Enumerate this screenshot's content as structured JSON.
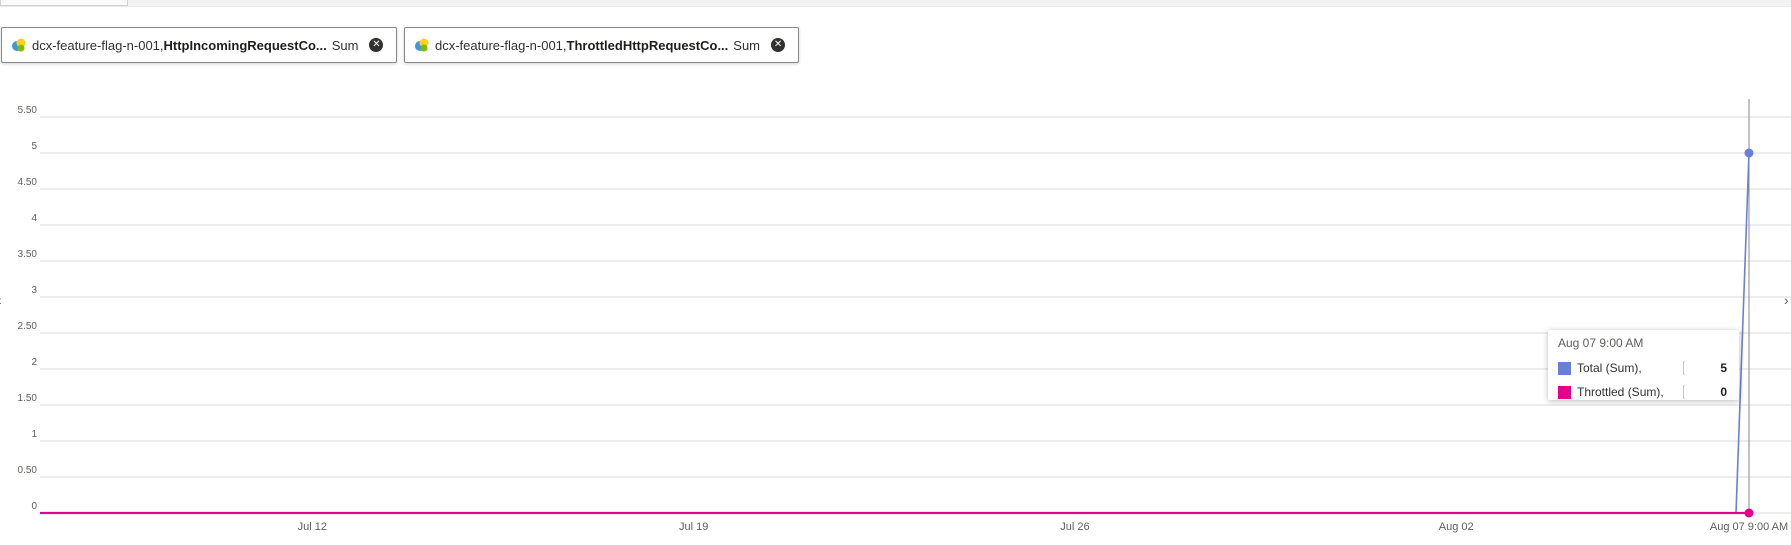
{
  "pills": [
    {
      "resource": "dcx-feature-flag-n-001,",
      "metric": "HttpIncomingRequestCo...",
      "aggregation": "Sum",
      "icon": "resource-icon"
    },
    {
      "resource": "dcx-feature-flag-n-001,",
      "metric": "ThrottledHttpRequestCo...",
      "aggregation": "Sum",
      "icon": "resource-icon"
    }
  ],
  "tooltip": {
    "title": "Aug 07 9:00 AM",
    "rows": [
      {
        "label": "Total (Sum),",
        "value": "5",
        "color": "#6a7fdb"
      },
      {
        "label": "Throttled (Sum),",
        "value": "0",
        "color": "#e3008c"
      }
    ]
  },
  "icons": {
    "close": "close-circle-icon",
    "nav_left": "chevron-left-icon",
    "nav_right": "chevron-right-icon"
  },
  "chart_data": {
    "type": "line",
    "x_range": [
      "Jul 07 2024",
      "Aug 07 2024 9:00 AM"
    ],
    "x_ticks": [
      {
        "label": "Jul 12",
        "date": "Jul 12"
      },
      {
        "label": "Jul 19",
        "date": "Jul 19"
      },
      {
        "label": "Jul 26",
        "date": "Jul 26"
      },
      {
        "label": "Aug 02",
        "date": "Aug 02"
      },
      {
        "label": "Aug 07 9:00 AM",
        "date": "Aug 07 9:00 AM"
      }
    ],
    "y_ticks": [
      "0",
      "0.50",
      "1",
      "1.50",
      "2",
      "2.50",
      "3",
      "3.50",
      "4",
      "4.50",
      "5",
      "5.50"
    ],
    "ylim": [
      0,
      5.5
    ],
    "grid": true,
    "series": [
      {
        "name": "Total (Sum),",
        "color": "#6a7fdb",
        "points": [
          [
            "Jul 07 00:00",
            0
          ],
          [
            "Aug 07 09:00",
            5
          ]
        ]
      },
      {
        "name": "Throttled (Sum),",
        "color": "#e3008c",
        "points": [
          [
            "Jul 07 00:00",
            0
          ],
          [
            "Aug 07 09:00",
            0
          ]
        ]
      }
    ]
  }
}
